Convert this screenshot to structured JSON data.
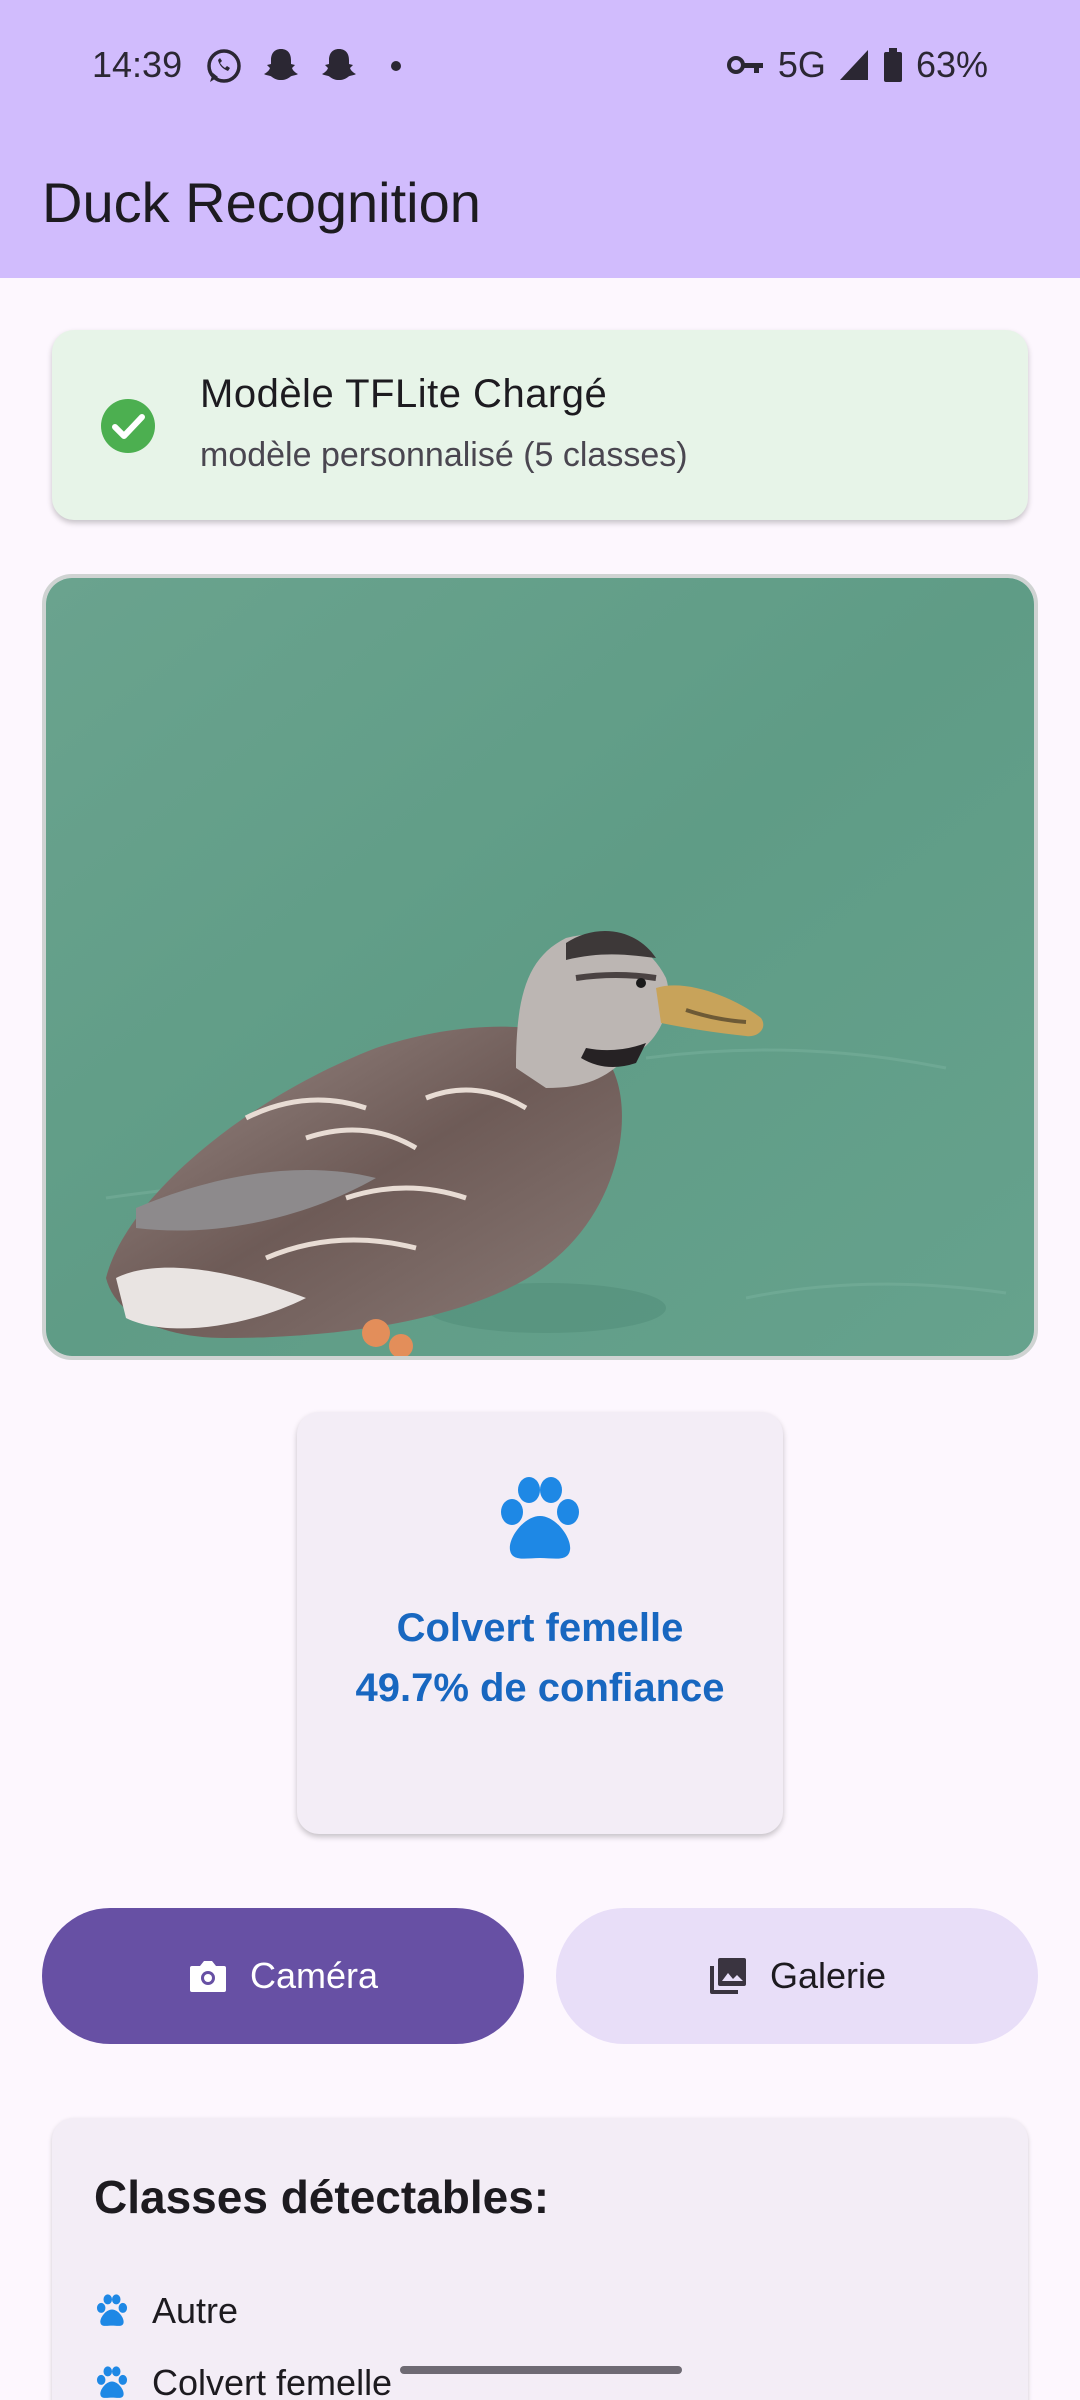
{
  "status_bar": {
    "time": "14:39",
    "network": "5G",
    "battery": "63%"
  },
  "app_bar": {
    "title": "Duck Recognition"
  },
  "model_status": {
    "title": "Modèle TFLite Chargé",
    "subtitle": "modèle personnalisé (5 classes)",
    "icon": "check-circle-icon",
    "color": "#4caf50"
  },
  "result": {
    "label": "Colvert femelle",
    "confidence_text": "49.7% de confiance",
    "icon": "paw-icon",
    "color": "#1867c0"
  },
  "actions": {
    "camera_label": "Caméra",
    "gallery_label": "Galerie"
  },
  "classes": {
    "title": "Classes détectables:",
    "items": [
      "Autre",
      "Colvert femelle"
    ]
  },
  "colors": {
    "app_bar": "#d1bcfd",
    "primary": "#6750a4",
    "secondary_container": "#e8def8",
    "success_bg": "#e7f4e8",
    "accent_blue": "#1e88e5"
  }
}
